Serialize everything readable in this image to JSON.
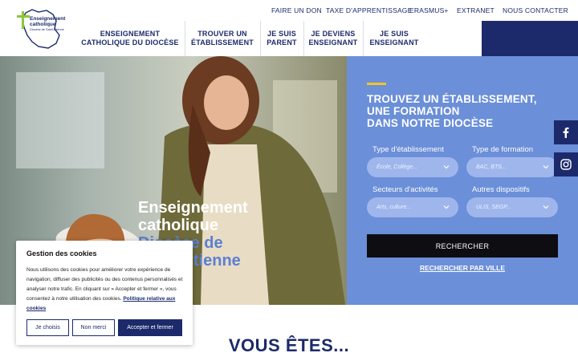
{
  "logo": {
    "line1": "Enseignement",
    "line2": "catholique",
    "subtitle": "Diocèse de Saint-Étienne"
  },
  "topbar": {
    "links": [
      "FAIRE UN DON",
      "TAXE D'APPRENTISSAGE",
      "ERASMUS+",
      "EXTRANET",
      "NOUS CONTACTER"
    ]
  },
  "nav": {
    "items": [
      {
        "line1": "ENSEIGNEMENT",
        "line2": "CATHOLIQUE DU DIOCÈSE"
      },
      {
        "line1": "TROUVER UN",
        "line2": "ÉTABLISSEMENT"
      },
      {
        "line1": "JE SUIS",
        "line2": "PARENT"
      },
      {
        "line1": "JE DEVIENS",
        "line2": "ENSEIGNANT"
      },
      {
        "line1": "JE SUIS",
        "line2": "ENSEIGNANT"
      }
    ]
  },
  "hero": {
    "title_lines": [
      "Enseignement",
      "catholique",
      "Diocèse de",
      "Saint-Étienne"
    ]
  },
  "search": {
    "title_lines": [
      "TROUVEZ UN ÉTABLISSEMENT,",
      "UNE FORMATION",
      "DANS NOTRE DIOCÈSE"
    ],
    "fields": [
      {
        "label": "Type d'établissement",
        "placeholder": "École, Collège..."
      },
      {
        "label": "Type de formation",
        "placeholder": "BAC, BTS..."
      },
      {
        "label": "Secteurs d'activités",
        "placeholder": "Arts, culture..."
      },
      {
        "label": "Autres dispositifs",
        "placeholder": "ULIS, SEGP..."
      }
    ],
    "button_label": "RECHERCHER",
    "city_link": "RECHERCHER PAR VILLE"
  },
  "social": {
    "facebook_icon": "facebook-icon",
    "instagram_icon": "instagram-icon"
  },
  "section": {
    "title": "VOUS ÊTES..."
  },
  "cookie": {
    "title": "Gestion des cookies",
    "body": "Nous utilisons des cookies pour améliorer votre expérience de navigation, diffuser des publicités ou des contenus personnalisés et analyser notre trafic. En cliquant sur « Accepter et fermer », vous consentez à notre utilisation des cookies.",
    "policy_link": "Politique relative aux cookies",
    "buttons": {
      "choose": "Je choisis",
      "refuse": "Non merci",
      "accept": "Accepter et fermer"
    }
  },
  "colors": {
    "navy": "#1c2a6b",
    "panel_blue": "#6b8fd8",
    "field_blue": "#9fb6ec",
    "accent_yellow": "#f3c428",
    "logo_green": "#8cc63f",
    "button_black": "#0d0d12"
  }
}
